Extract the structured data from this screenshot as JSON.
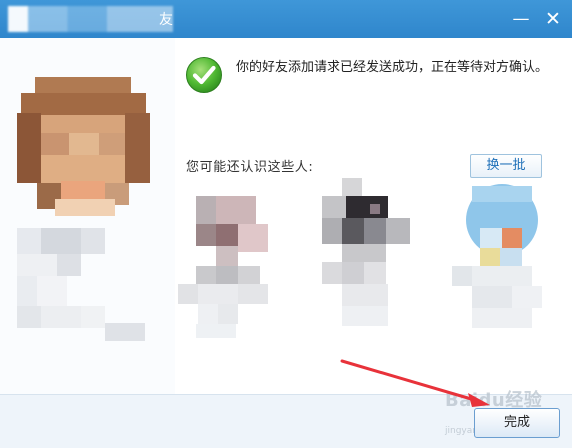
{
  "window": {
    "title_visible_suffix": "友",
    "minimize_label": "—",
    "close_label": "✕"
  },
  "message": {
    "text": "你的好友添加请求已经发送成功，正在等待对方确认。"
  },
  "suggestions": {
    "label": "您可能还认识这些人:",
    "switch_button": "换一批"
  },
  "footer": {
    "done_button": "完成"
  },
  "watermark": {
    "text": "Baidu经验",
    "sub": "jingyan.baidu.com"
  },
  "colors": {
    "titlebar": "#3f97d8",
    "accent_arrow": "#e8323a",
    "success_green": "#3aa52b"
  },
  "icons": {
    "success": "check-circle-icon"
  }
}
